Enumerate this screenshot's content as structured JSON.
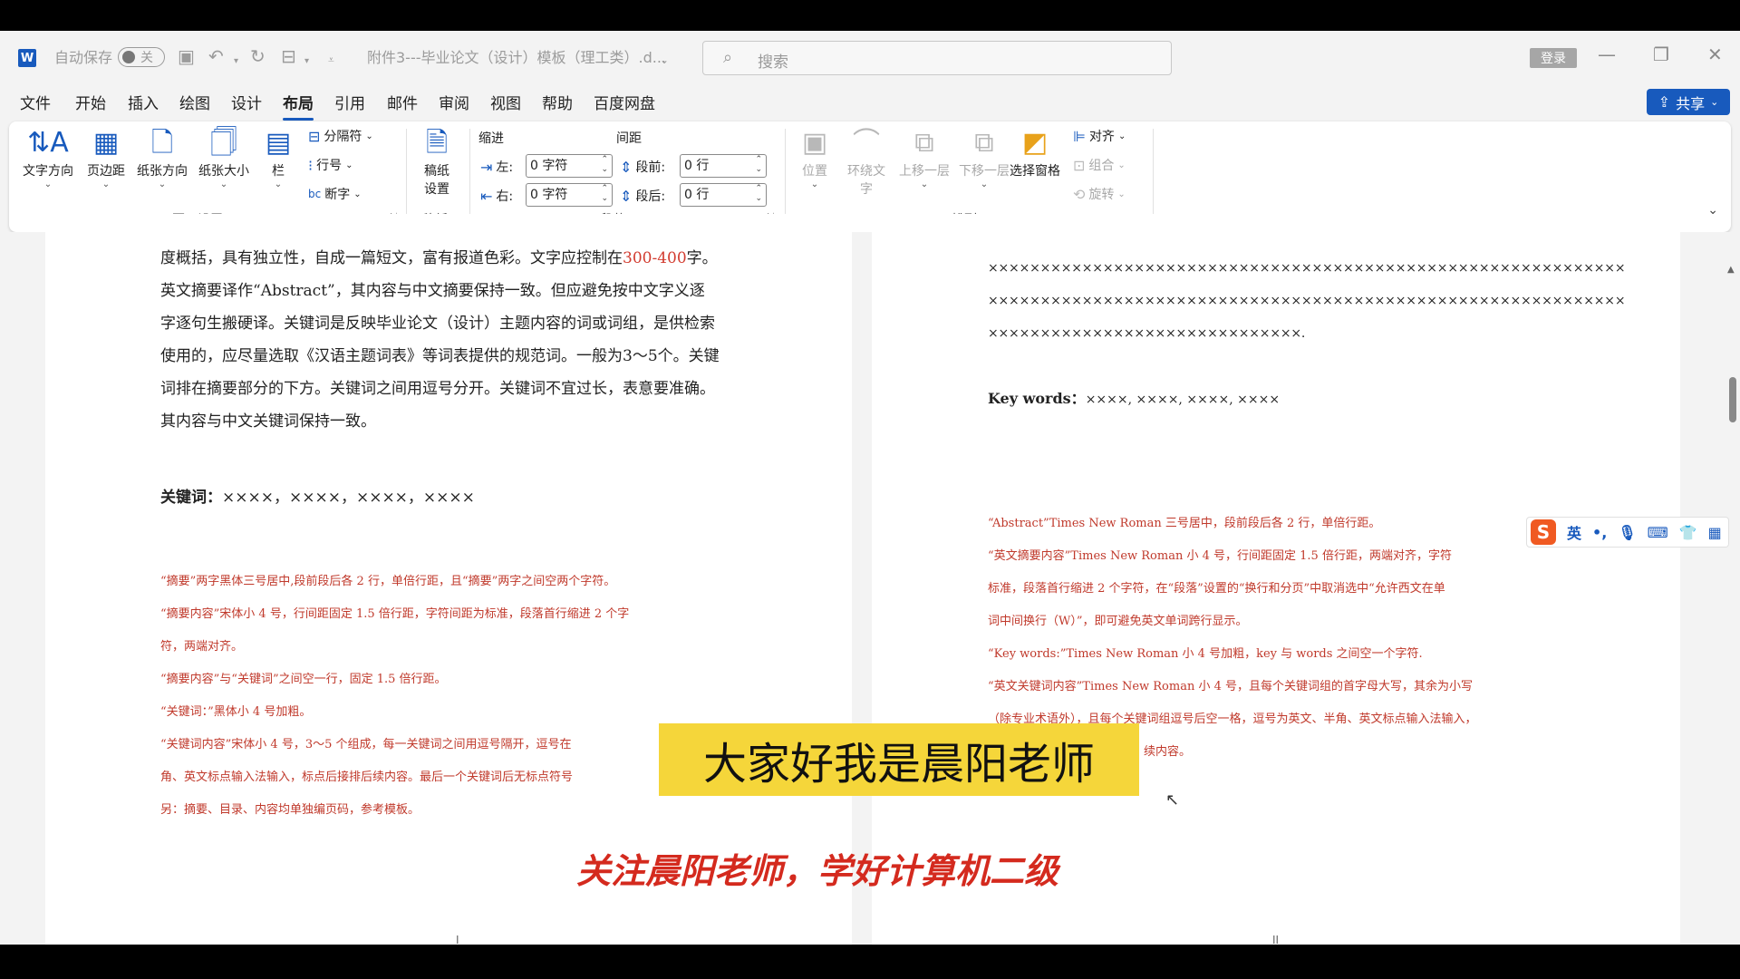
{
  "titlebar": {
    "autosave_label": "自动保存",
    "autosave_state": "关",
    "doc_title": "附件3---毕业论文（设计）模板（理工类）.d...",
    "search_placeholder": "搜索",
    "login_label": "登录"
  },
  "menu": {
    "tabs": [
      "文件",
      "开始",
      "插入",
      "绘图",
      "设计",
      "布局",
      "引用",
      "邮件",
      "审阅",
      "视图",
      "帮助",
      "百度网盘"
    ],
    "share_label": "共享"
  },
  "ribbon": {
    "page_setup": {
      "text_direction": "文字方向",
      "margins": "页边距",
      "orientation": "纸张方向",
      "size": "纸张大小",
      "columns": "栏",
      "breaks": "分隔符",
      "line_numbers": "行号",
      "hyphenation": "断字",
      "group_label": "页面设置"
    },
    "manuscript": {
      "button_line1": "稿纸",
      "button_line2": "设置",
      "group_label": "稿纸"
    },
    "paragraph": {
      "indent_label": "缩进",
      "spacing_label": "间距",
      "left_label": "左:",
      "right_label": "右:",
      "before_label": "段前:",
      "after_label": "段后:",
      "left_value": "0 字符",
      "right_value": "0 字符",
      "before_value": "0 行",
      "after_value": "0 行",
      "group_label": "段落"
    },
    "arrange": {
      "position": "位置",
      "wrap_line1": "环绕文",
      "wrap_line2": "字",
      "bring_forward": "上移一层",
      "send_backward": "下移一层",
      "selection_pane": "选择窗格",
      "align": "对齐",
      "group": "组合",
      "rotate": "旋转",
      "group_label": "排列"
    }
  },
  "left_page": {
    "line1_a": "度概括，具有独立性，自成一篇短文，富有报道色彩。文字应控制在",
    "line1_num": "300-400",
    "line1_b": "字。",
    "line2": "英文摘要译作“Abstract”，其内容与中文摘要保持一致。但应避免按中文字义逐",
    "line3": "字逐句生搬硬译。关键词是反映毕业论文（设计）主题内容的词或词组，是供检索",
    "line4": "使用的，应尽量选取《汉语主题词表》等词表提供的规范词。一般为3～5个。关键",
    "line5": "词排在摘要部分的下方。关键词之间用逗号分开。关键词不宜过长，表意要准确。",
    "line6": "其内容与中文关键词保持一致。",
    "keywords_label": "关键词：",
    "keywords_value": "××××，××××，××××，××××",
    "notes": [
      "“摘要”两字黑体三号居中,段前段后各 2 行，单倍行距，且“摘要”两字之间空两个字符。",
      "“摘要内容”宋体小 4 号，行间距固定 1.5 倍行距，字符间距为标准，段落首行缩进 2 个字",
      "符，两端对齐。",
      "“摘要内容”与“关键词”之间空一行，固定 1.5 倍行距。",
      "“关键词：”黑体小 4 号加粗。",
      "“关键词内容”宋体小 4 号，3～5 个组成，每一关键词之间用逗号隔开，逗号在",
      "角、英文标点输入法输入，标点后接排后续内容。最后一个关键词后无标点符号",
      "另：摘要、目录、内容均单独编页码，参考模板。"
    ]
  },
  "right_page": {
    "x_line1": "×××××××××××××××××××××××××××××××××××××××××××××××××××××××××××××",
    "x_line2": "×××××××××××××××××××××××××××××××××××××××××××××××××××××××××××××",
    "x_line3": "××××××××××××××××××××××××××××××.",
    "keywords_label": "Key words：",
    "keywords_value": "××××, ××××, ××××, ××××",
    "notes": [
      "“Abstract”Times New Roman 三号居中，段前段后各 2 行，单倍行距。",
      "“英文摘要内容”Times New Roman 小 4 号，行间距固定 1.5 倍行距，两端对齐，字符",
      "标准，段落首行缩进 2 个字符，在“段落”设置的“换行和分页”中取消选中“允许西文在单",
      "词中间换行（W）”，即可避免英文单词跨行显示。",
      "“Key words:”Times New Roman 小 4 号加粗，key 与 words 之间空一个字符.",
      "“英文关键词内容”Times  New  Roman 小 4 号，且每个关键词组的首字母大写，其余为小写",
      "（除专业术语外），且每个关键词组逗号后空一格，逗号为英文、半角、英文标点输入法输入，",
      "续内容。"
    ]
  },
  "ime": {
    "logo": "S",
    "mode": "英",
    "punct": "•,"
  },
  "overlay": {
    "subtitle": "大家好我是晨阳老师",
    "follow": "关注晨阳老师，学好计算机二级"
  },
  "page_marks": {
    "left": "I",
    "right": "II"
  },
  "colors": {
    "accent": "#185abd",
    "note_red": "#c0392b",
    "subtitle_bg": "#f5d63a",
    "follow_red": "#d42a1e"
  }
}
